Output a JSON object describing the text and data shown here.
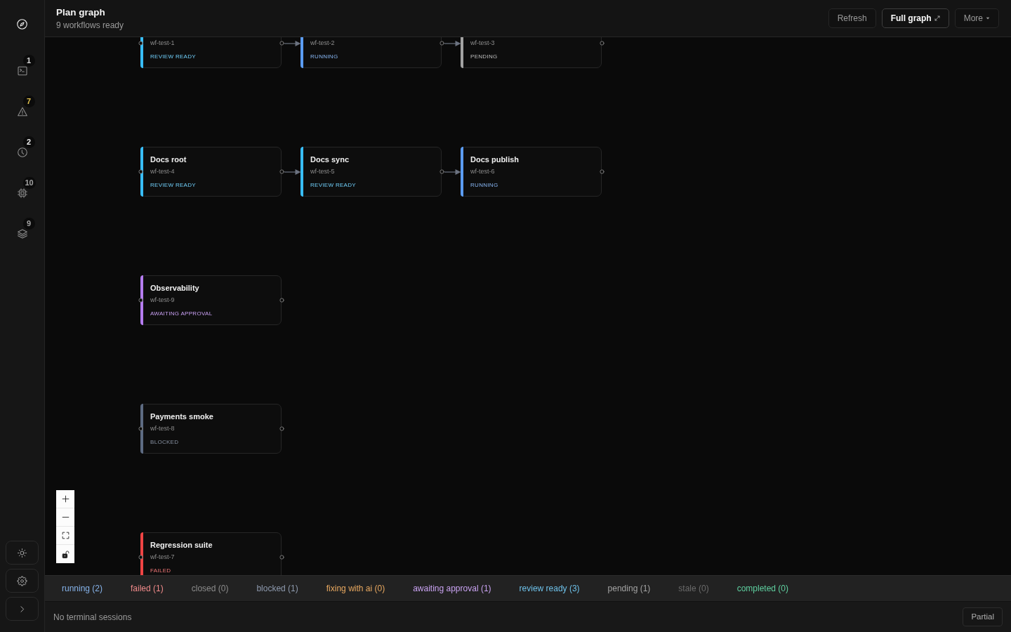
{
  "sidebar": {
    "items": [
      {
        "selected": true
      },
      {
        "selected": false,
        "badge": {
          "count": "1",
          "color": "#d4d4d4"
        }
      },
      {
        "selected": false,
        "badge": {
          "count": "7",
          "color": "#e3c34f"
        }
      },
      {
        "selected": false,
        "badge": {
          "count": "2",
          "color": "#ececec"
        }
      },
      {
        "selected": false,
        "badge": {
          "count": "10",
          "color": "#a3a3a3"
        }
      },
      {
        "selected": false,
        "badge": {
          "count": "9",
          "color": "#a3a3a3"
        }
      }
    ]
  },
  "header": {
    "title": "Plan graph",
    "subtitle": "9 workflows ready",
    "buttons": [
      {
        "label": "Refresh",
        "kind": "plain",
        "selected": false
      },
      {
        "label": "Full graph",
        "kind": "expand",
        "selected": true
      },
      {
        "label": "More",
        "kind": "menu",
        "selected": false
      }
    ]
  },
  "graph": {
    "lanes": [
      {
        "nodes": [
          {
            "id_label": "wf-test-1",
            "status": "REVIEW READY",
            "color": "#38bdf8",
            "incoming_edge": false
          },
          {
            "id_label": "wf-test-2",
            "status": "RUNNING",
            "color": "#5b9cf2",
            "incoming_edge": true
          },
          {
            "id_label": "wf-test-3",
            "status": "PENDING",
            "color": "#a3a3a3",
            "incoming_edge": true
          }
        ]
      },
      {
        "nodes": [
          {
            "title": "Docs root",
            "id_label": "wf-test-4",
            "status": "REVIEW READY",
            "color": "#38bdf8",
            "incoming_edge": false
          },
          {
            "title": "Docs sync",
            "id_label": "wf-test-5",
            "status": "REVIEW READY",
            "color": "#38bdf8",
            "incoming_edge": true
          },
          {
            "title": "Docs publish",
            "id_label": "wf-test-6",
            "status": "RUNNING",
            "color": "#5b9cf2",
            "incoming_edge": true
          }
        ]
      },
      {
        "nodes": [
          {
            "title": "Observability",
            "id_label": "wf-test-9",
            "status": "AWAITING APPROVAL",
            "color": "#b57cf0",
            "incoming_edge": false
          }
        ]
      },
      {
        "nodes": [
          {
            "title": "Payments smoke",
            "id_label": "wf-test-8",
            "status": "BLOCKED",
            "color": "#5d6b82",
            "incoming_edge": false
          }
        ]
      },
      {
        "nodes": [
          {
            "title": "Regression suite",
            "id_label": "wf-test-7",
            "status": "FAILED",
            "color": "#ef4444",
            "incoming_edge": false
          }
        ]
      }
    ]
  },
  "status_filters": [
    {
      "label": "running (2)",
      "color": "#86b3ea"
    },
    {
      "label": "failed (1)",
      "color": "#f08a8a"
    },
    {
      "label": "closed (0)",
      "color": "#8c8c8c"
    },
    {
      "label": "blocked (1)",
      "color": "#8e9aae"
    },
    {
      "label": "fixing with ai (0)",
      "color": "#e8a860"
    },
    {
      "label": "awaiting approval (1)",
      "color": "#c8a2f0"
    },
    {
      "label": "review ready (3)",
      "color": "#6ec0e8"
    },
    {
      "label": "pending (1)",
      "color": "#a3a3a3"
    },
    {
      "label": "stale (0)",
      "color": "#6b6b6b"
    },
    {
      "label": "completed (0)",
      "color": "#5fd0a0"
    }
  ],
  "terminal": {
    "message": "No terminal sessions",
    "button": "Partial"
  }
}
